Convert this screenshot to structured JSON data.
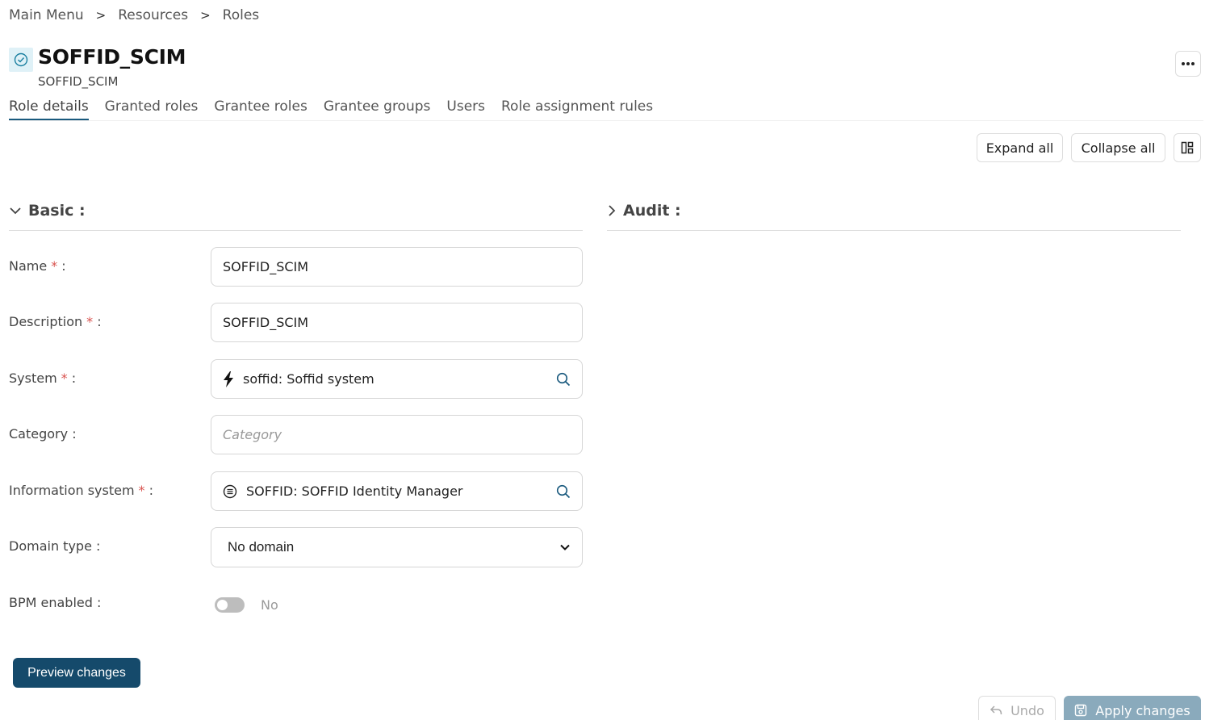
{
  "breadcrumb": {
    "items": [
      "Main Menu",
      "Resources",
      "Roles"
    ],
    "separator": ">"
  },
  "header": {
    "title": "SOFFID_SCIM",
    "subtitle": "SOFFID_SCIM",
    "status_icon": "check-circle-icon",
    "more_icon": "more-horizontal-icon"
  },
  "tabs": [
    {
      "label": "Role details",
      "active": true
    },
    {
      "label": "Granted roles"
    },
    {
      "label": "Grantee roles"
    },
    {
      "label": "Grantee groups"
    },
    {
      "label": "Users"
    },
    {
      "label": "Role assignment rules"
    }
  ],
  "toolbar": {
    "expand_label": "Expand all",
    "collapse_label": "Collapse all",
    "layout_icon": "layout-grid-icon"
  },
  "sections": {
    "basic": "Basic :",
    "audit": "Audit :"
  },
  "form": {
    "name": {
      "label": "Name",
      "required": "*",
      "suffix": ":",
      "value": "SOFFID_SCIM"
    },
    "description": {
      "label": "Description",
      "required": "*",
      "suffix": ":",
      "value": "SOFFID_SCIM"
    },
    "system": {
      "label": "System",
      "required": "*",
      "suffix": ":",
      "value": "soffid: Soffid system",
      "icon": "lightning-icon"
    },
    "category": {
      "label": "Category",
      "suffix": ":",
      "placeholder": "Category"
    },
    "information_system": {
      "label": "Information system",
      "required": "*",
      "suffix": ":",
      "value": "SOFFID: SOFFID Identity Manager",
      "icon": "list-circle-icon"
    },
    "domain_type": {
      "label": "Domain type",
      "suffix": ":",
      "value": "No domain"
    },
    "bpm_enabled": {
      "label": "BPM enabled",
      "suffix": ":",
      "value": "No",
      "on": false
    }
  },
  "actions": {
    "preview": "Preview changes",
    "undo": "Undo",
    "apply": "Apply changes"
  },
  "colors": {
    "primary": "#154a6b",
    "required": "#d9534f",
    "apply_disabled": "#8aaabc",
    "tab_underline": "#1a5a7e"
  }
}
